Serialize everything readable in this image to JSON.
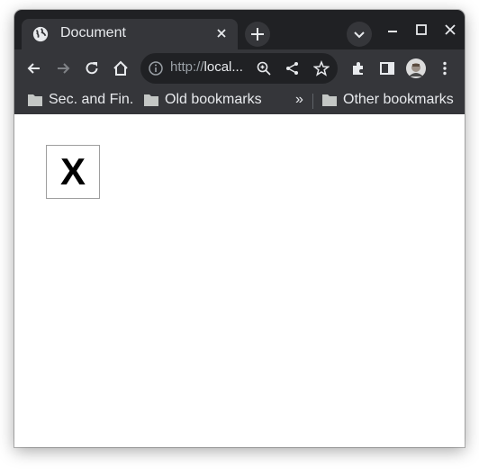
{
  "tab": {
    "title": "Document"
  },
  "address_bar": {
    "scheme": "http://",
    "host": "local..."
  },
  "bookmarks": {
    "items": [
      "Sec. and Fin.",
      "Old bookmarks"
    ],
    "overflow": "»",
    "other": "Other bookmarks"
  },
  "page": {
    "box_text": "X"
  },
  "icons": {
    "tab": [
      "globe-icon",
      "close-icon"
    ],
    "titlebar": [
      "plus-icon",
      "chevron-down-icon",
      "minimize-icon",
      "maximize-icon",
      "close-icon"
    ],
    "toolbar": [
      "back-arrow-icon",
      "forward-arrow-icon",
      "reload-icon",
      "home-icon",
      "info-icon",
      "zoom-icon",
      "share-icon",
      "star-icon",
      "puzzle-icon",
      "side-panel-icon",
      "avatar",
      "kebab-menu-icon"
    ],
    "bookmarks": [
      "folder-icon"
    ]
  },
  "colors": {
    "titlebar": "#202124",
    "toolbar": "#35363a",
    "text": "#e8eaed",
    "muted": "#9aa0a6"
  }
}
